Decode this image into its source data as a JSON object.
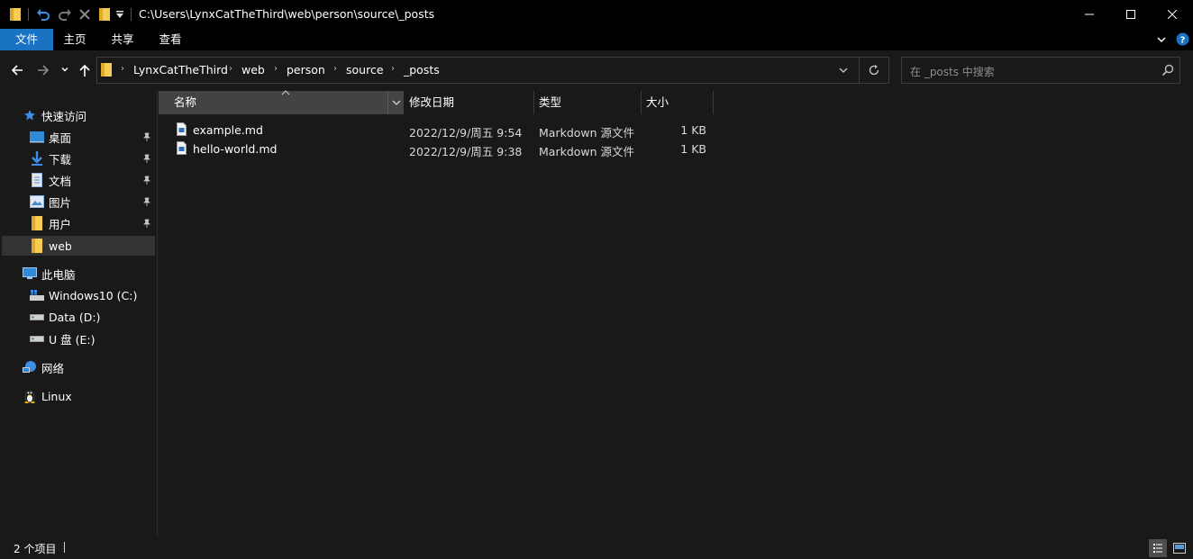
{
  "titlebar": {
    "path": "C:\\Users\\LynxCatTheThird\\web\\person\\source\\_posts"
  },
  "ribbon": {
    "tabs": [
      "文件",
      "主页",
      "共享",
      "查看"
    ]
  },
  "address": {
    "crumbs": [
      "LynxCatTheThird",
      "web",
      "person",
      "source",
      "_posts"
    ]
  },
  "search": {
    "placeholder": "在 _posts 中搜索"
  },
  "sidebar": {
    "quick_access": "快速访问",
    "pinned": [
      "桌面",
      "下载",
      "文档",
      "图片",
      "用户"
    ],
    "recent": "web",
    "this_pc": "此电脑",
    "drives": [
      "Windows10 (C:)",
      "Data (D:)",
      "U 盘 (E:)"
    ],
    "network": "网络",
    "linux": "Linux"
  },
  "columns": {
    "name": "名称",
    "modified": "修改日期",
    "type": "类型",
    "size": "大小"
  },
  "files": [
    {
      "name": "example.md",
      "modified": "2022/12/9/周五 9:54",
      "type": "Markdown 源文件",
      "size": "1 KB"
    },
    {
      "name": "hello-world.md",
      "modified": "2022/12/9/周五 9:38",
      "type": "Markdown 源文件",
      "size": "1 KB"
    }
  ],
  "status": {
    "item_count": "2 个项目"
  },
  "colors": {
    "accent": "#1a72c2",
    "background": "#191919",
    "titlebar": "#000000",
    "folder": "#f5cc54"
  }
}
